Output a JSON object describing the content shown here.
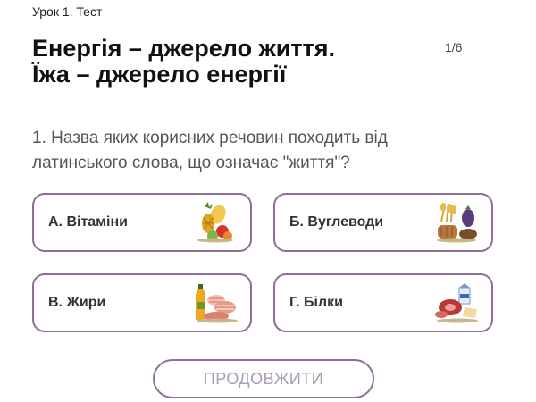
{
  "header": {
    "breadcrumb": "Урок 1. Тест",
    "title_line1": "Енергія – джерело життя.",
    "title_line2": "Їжа – джерело енергії",
    "progress": "1/6"
  },
  "question": {
    "text": "1. Назва яких корисних речовин походить від латинського слова, що означає \"життя\"?"
  },
  "options": [
    {
      "label": "А. Вітаміни",
      "icon": "fruits-icon"
    },
    {
      "label": "Б. Вуглеводи",
      "icon": "bread-grain-icon"
    },
    {
      "label": "В. Жири",
      "icon": "oil-fats-icon"
    },
    {
      "label": "Г. Білки",
      "icon": "meat-dairy-icon"
    }
  ],
  "actions": {
    "continue_label": "ПРОДОВЖИТИ"
  },
  "colors": {
    "border": "#8c6e98",
    "button_text": "#a99cb3",
    "question_text": "#555555"
  }
}
